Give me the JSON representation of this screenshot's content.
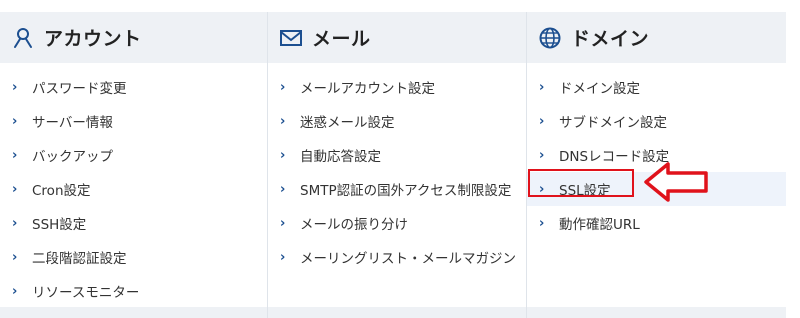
{
  "columns": [
    {
      "title": "アカウント",
      "icon": "account-icon",
      "items": [
        "パスワード変更",
        "サーバー情報",
        "バックアップ",
        "Cron設定",
        "SSH設定",
        "二段階認証設定",
        "リソースモニター"
      ]
    },
    {
      "title": "メール",
      "icon": "mail-icon",
      "items": [
        "メールアカウント設定",
        "迷惑メール設定",
        "自動応答設定",
        "SMTP認証の国外アクセス制限設定",
        "メールの振り分け",
        "メーリングリスト・メールマガジン"
      ]
    },
    {
      "title": "ドメイン",
      "icon": "globe-icon",
      "items": [
        "ドメイン設定",
        "サブドメイン設定",
        "DNSレコード設定",
        "SSL設定",
        "動作確認URL"
      ],
      "active_item": "SSL設定"
    }
  ],
  "colors": {
    "accent": "#1c4f90",
    "highlight": "#e0121b",
    "header_bg": "#eef1f5"
  }
}
